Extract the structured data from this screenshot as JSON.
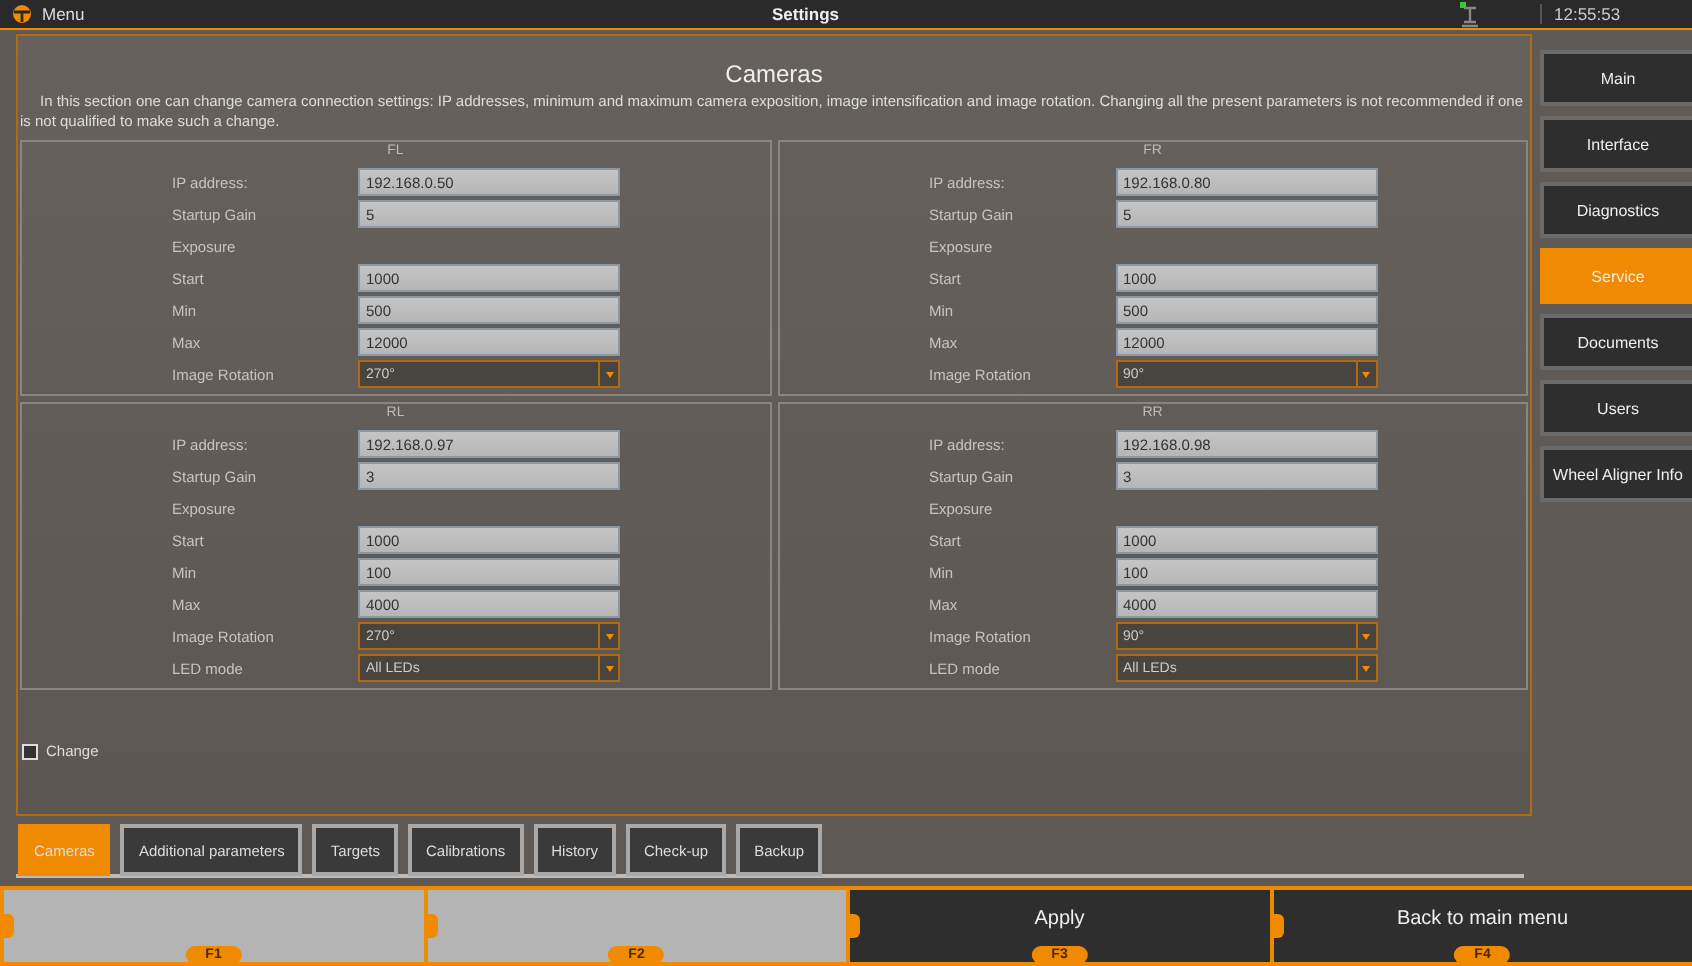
{
  "top_bar": {
    "menu_label": "Menu",
    "title": "Settings",
    "time": "12:55:53"
  },
  "section": {
    "title": "Cameras",
    "description": "In this section one can change camera connection settings: IP addresses, minimum and maximum camera exposition, image intensification and image rotation. Changing all the present parameters is not recommended if one is not qualified to make such a change."
  },
  "cameras": [
    {
      "name": "FL",
      "fields": [
        {
          "kind": "text",
          "label": "IP address:",
          "value": "192.168.0.50"
        },
        {
          "kind": "text",
          "label": "Startup Gain",
          "value": "5"
        },
        {
          "kind": "heading",
          "label": "Exposure"
        },
        {
          "kind": "text",
          "label": "Start",
          "value": "1000"
        },
        {
          "kind": "text",
          "label": "Min",
          "value": "500"
        },
        {
          "kind": "text",
          "label": "Max",
          "value": "12000"
        },
        {
          "kind": "select",
          "label": "Image Rotation",
          "value": "270°"
        }
      ]
    },
    {
      "name": "FR",
      "fields": [
        {
          "kind": "text",
          "label": "IP address:",
          "value": "192.168.0.80"
        },
        {
          "kind": "text",
          "label": "Startup Gain",
          "value": "5"
        },
        {
          "kind": "heading",
          "label": "Exposure"
        },
        {
          "kind": "text",
          "label": "Start",
          "value": "1000"
        },
        {
          "kind": "text",
          "label": "Min",
          "value": "500"
        },
        {
          "kind": "text",
          "label": "Max",
          "value": "12000"
        },
        {
          "kind": "select",
          "label": "Image Rotation",
          "value": "90°"
        }
      ]
    },
    {
      "name": "RL",
      "fields": [
        {
          "kind": "text",
          "label": "IP address:",
          "value": "192.168.0.97"
        },
        {
          "kind": "text",
          "label": "Startup Gain",
          "value": "3"
        },
        {
          "kind": "heading",
          "label": "Exposure"
        },
        {
          "kind": "text",
          "label": "Start",
          "value": "1000"
        },
        {
          "kind": "text",
          "label": "Min",
          "value": "100"
        },
        {
          "kind": "text",
          "label": "Max",
          "value": "4000"
        },
        {
          "kind": "select",
          "label": "Image Rotation",
          "value": "270°"
        },
        {
          "kind": "select",
          "label": "LED mode",
          "value": "All LEDs"
        }
      ]
    },
    {
      "name": "RR",
      "fields": [
        {
          "kind": "text",
          "label": "IP address:",
          "value": "192.168.0.98"
        },
        {
          "kind": "text",
          "label": "Startup Gain",
          "value": "3"
        },
        {
          "kind": "heading",
          "label": "Exposure"
        },
        {
          "kind": "text",
          "label": "Start",
          "value": "1000"
        },
        {
          "kind": "text",
          "label": "Min",
          "value": "100"
        },
        {
          "kind": "text",
          "label": "Max",
          "value": "4000"
        },
        {
          "kind": "select",
          "label": "Image Rotation",
          "value": "90°"
        },
        {
          "kind": "select",
          "label": "LED mode",
          "value": "All LEDs"
        }
      ]
    }
  ],
  "change_checkbox": {
    "label": "Change",
    "checked": false
  },
  "tabs": [
    {
      "label": "Cameras",
      "selected": true
    },
    {
      "label": "Additional parameters",
      "selected": false
    },
    {
      "label": "Targets",
      "selected": false
    },
    {
      "label": "Calibrations",
      "selected": false
    },
    {
      "label": "History",
      "selected": false
    },
    {
      "label": "Check-up",
      "selected": false
    },
    {
      "label": "Backup",
      "selected": false
    }
  ],
  "sidebar": [
    {
      "label": "Main",
      "selected": false
    },
    {
      "label": "Interface",
      "selected": false
    },
    {
      "label": "Diagnostics",
      "selected": false
    },
    {
      "label": "Service",
      "selected": true
    },
    {
      "label": "Documents",
      "selected": false
    },
    {
      "label": "Users",
      "selected": false
    },
    {
      "label": "Wheel Aligner Info",
      "selected": false
    }
  ],
  "function_keys": [
    {
      "key": "F1",
      "disabled": true
    },
    {
      "key": "F2",
      "disabled": true
    },
    {
      "key": "F3",
      "label": "Apply",
      "disabled": false
    },
    {
      "key": "F4",
      "label": "Back to main menu",
      "disabled": false
    }
  ]
}
